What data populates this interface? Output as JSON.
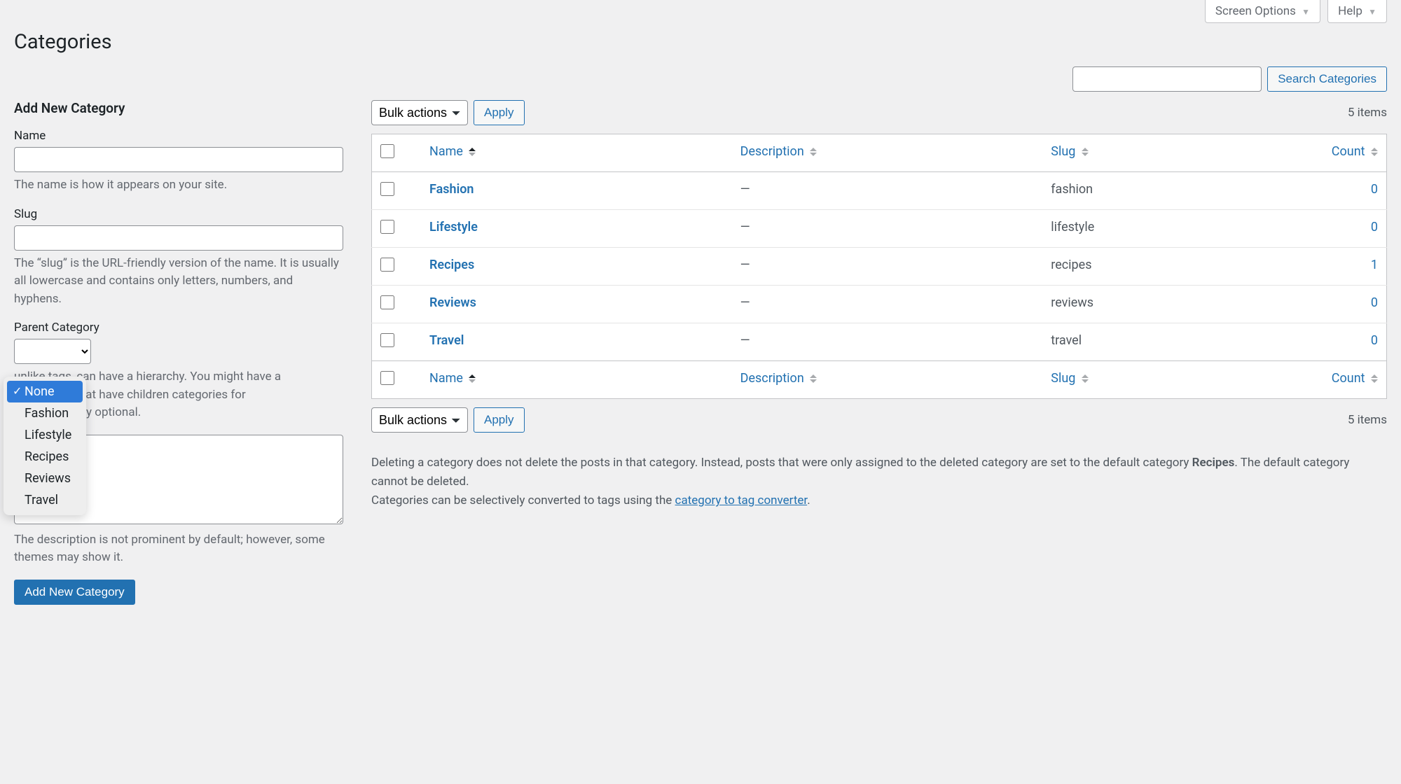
{
  "topTabs": {
    "screenOptions": "Screen Options",
    "help": "Help"
  },
  "pageTitle": "Categories",
  "search": {
    "placeholder": "",
    "buttonLabel": "Search Categories"
  },
  "addForm": {
    "heading": "Add New Category",
    "name": {
      "label": "Name",
      "help": "The name is how it appears on your site."
    },
    "slug": {
      "label": "Slug",
      "help": "The “slug” is the URL-friendly version of the name. It is usually all lowercase and contains only letters, numbers, and hyphens."
    },
    "parent": {
      "label": "Parent Category",
      "helpPart1": "unlike tags, can have a hierarchy. You might have a",
      "helpPart2": ", and under that have children categories for",
      "helpPart3": "g Band. Totally optional.",
      "options": [
        "None",
        "Fashion",
        "Lifestyle",
        "Recipes",
        "Reviews",
        "Travel"
      ],
      "selected": "None"
    },
    "description": {
      "help": "The description is not prominent by default; however, some themes may show it."
    },
    "submitLabel": "Add New Category"
  },
  "bulk": {
    "label": "Bulk actions",
    "applyLabel": "Apply"
  },
  "itemsCount": "5 items",
  "columns": {
    "name": "Name",
    "description": "Description",
    "slug": "Slug",
    "count": "Count"
  },
  "rows": [
    {
      "name": "Fashion",
      "desc": "—",
      "slug": "fashion",
      "count": "0",
      "child": false
    },
    {
      "name": "Lifestyle",
      "desc": "—",
      "slug": "lifestyle",
      "count": "0",
      "child": false
    },
    {
      "name": "Recipes",
      "desc": "—",
      "slug": "recipes",
      "count": "1",
      "child": true
    },
    {
      "name": "Reviews",
      "desc": "—",
      "slug": "reviews",
      "count": "0",
      "child": false
    },
    {
      "name": "Travel",
      "desc": "—",
      "slug": "travel",
      "count": "0",
      "child": false
    }
  ],
  "notes": {
    "deletePart1": "Deleting a category does not delete the posts in that category. Instead, posts that were only assigned to the deleted category are set to the default category ",
    "defaultCat": "Recipes",
    "deletePart2": ". The default category cannot be deleted.",
    "convertPart1": "Categories can be selectively converted to tags using the ",
    "convertLink": "category to tag converter",
    "convertPart2": "."
  }
}
